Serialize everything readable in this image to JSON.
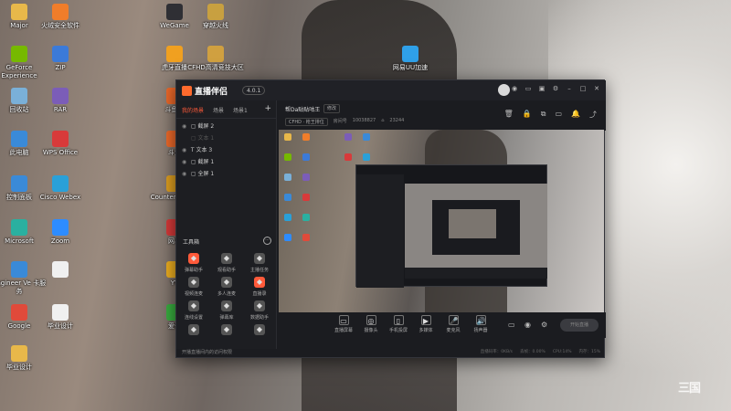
{
  "desktop": {
    "icons": [
      {
        "label": "Major",
        "icon": "folder-icon",
        "color": "#e8b84a"
      },
      {
        "label": "火绒安全软件",
        "icon": "shield-icon",
        "color": "#f07d2a"
      },
      {
        "label": "WeGame",
        "icon": "wegame-icon",
        "color": "#2f2f34"
      },
      {
        "label": "穿越火线",
        "icon": "game-icon",
        "color": "#c8a040"
      },
      {
        "label": "GeForce Experience",
        "icon": "geforce-icon",
        "color": "#76b900"
      },
      {
        "label": "ZIP",
        "icon": "zip-icon",
        "color": "#3b7ad8"
      },
      {
        "label": "虎牙直播",
        "icon": "huya-icon",
        "color": "#f0a020"
      },
      {
        "label": "CFHD高清竞技大区",
        "icon": "game-icon",
        "color": "#d0a040"
      },
      {
        "label": "网易UU加速",
        "icon": "uu-icon",
        "color": "#2fa0e8"
      },
      {
        "label": "回收站",
        "icon": "recycle-bin-icon",
        "color": "#7ab0d8"
      },
      {
        "label": "RAR",
        "icon": "rar-icon",
        "color": "#7b5db8"
      },
      {
        "label": "斗鱼直",
        "icon": "douyu-icon",
        "color": "#f06a2a"
      },
      {
        "label": "此电脑",
        "icon": "computer-icon",
        "color": "#3a8ad8"
      },
      {
        "label": "WPS Office",
        "icon": "wps-icon",
        "color": "#d83a3a"
      },
      {
        "label": "斗鱼",
        "icon": "douyu-icon",
        "color": "#f06a2a"
      },
      {
        "label": "控制面板",
        "icon": "control-panel-icon",
        "color": "#3a8ad8"
      },
      {
        "label": "Cisco Webex",
        "icon": "webex-icon",
        "color": "#2aa0d8"
      },
      {
        "label": "Counter Global",
        "icon": "cs-icon",
        "color": "#e0a020"
      },
      {
        "label": "Microsoft",
        "icon": "edge-icon",
        "color": "#2ab0a0"
      },
      {
        "label": "Zoom",
        "icon": "zoom-icon",
        "color": "#2d8cff"
      },
      {
        "label": "网易",
        "icon": "netease-icon",
        "color": "#d83a3a"
      },
      {
        "label": "Engineer Ve 卡服务",
        "icon": "tool-icon",
        "color": "#3a8ad8"
      },
      {
        "label": "",
        "icon": "file-icon",
        "color": "#f0f0f0"
      },
      {
        "label": "YY",
        "icon": "yy-icon",
        "color": "#f0b020"
      },
      {
        "label": "Google",
        "icon": "chrome-icon",
        "color": "#e04a3a"
      },
      {
        "label": "毕业设计",
        "icon": "file-icon",
        "color": "#f0f0f0"
      },
      {
        "label": "爱奇",
        "icon": "iqiyi-icon",
        "color": "#3ab040"
      },
      {
        "label": "毕业设计",
        "icon": "folder-icon",
        "color": "#e8b84a"
      }
    ]
  },
  "app": {
    "title": "直播伴侣",
    "version": "4.0.1",
    "window_controls": [
      "skin-icon",
      "message-icon",
      "gift-icon",
      "settings-icon",
      "minimize-icon",
      "maximize-icon",
      "close-icon"
    ],
    "tabs": [
      "我的场景",
      "场景",
      "场景1"
    ],
    "tab_add": "+",
    "scenes": [
      {
        "label": "截屏 2",
        "dim": false
      },
      {
        "label": "文本 1",
        "dim": true
      },
      {
        "label": "文本 3",
        "dim": false
      },
      {
        "label": "截屏 1",
        "dim": false
      },
      {
        "label": "全屏 1",
        "dim": false
      }
    ],
    "toolbox_title": "工具箱",
    "toolbox_more": "···",
    "tools": [
      {
        "label": "弹幕助手",
        "icon": "danmaku-icon",
        "color": "#ff5a3a"
      },
      {
        "label": "观看助手",
        "icon": "viewer-icon",
        "color": "#555"
      },
      {
        "label": "主播任务",
        "icon": "task-icon",
        "color": "#555"
      },
      {
        "label": "视频连麦",
        "icon": "video-link-icon",
        "color": "#555"
      },
      {
        "label": "多人连麦",
        "icon": "multi-link-icon",
        "color": "#555"
      },
      {
        "label": "直播录",
        "icon": "record-icon",
        "color": "#ff5a3a"
      },
      {
        "label": "连线设置",
        "icon": "connect-icon",
        "color": "#555"
      },
      {
        "label": "弹幕库",
        "icon": "library-icon",
        "color": "#555"
      },
      {
        "label": "数据助手",
        "icon": "data-icon",
        "color": "#555"
      },
      {
        "label": "",
        "icon": "game-pad-icon",
        "color": "#555"
      },
      {
        "label": "",
        "icon": "download-icon",
        "color": "#555"
      },
      {
        "label": "",
        "icon": "more-tool-icon",
        "color": "#555"
      }
    ],
    "notice": "开播直播间内的访问权限",
    "room": {
      "name": "帮Da贴贴咕王",
      "edit": "修改",
      "category": "CFHD · 枪王排位",
      "room_label": "房间号",
      "room_id": "10038827",
      "fans_icon": "home-icon",
      "fans": "23244",
      "tools": [
        "trash-icon",
        "lock-icon",
        "copy-icon",
        "screen-icon",
        "bell-icon",
        "share-icon"
      ]
    },
    "bottom": [
      {
        "label": "直播屏幕",
        "icon": "screen-cast-icon"
      },
      {
        "label": "摄像头",
        "icon": "camera-icon"
      },
      {
        "label": "手机投屏",
        "icon": "phone-cast-icon"
      },
      {
        "label": "多媒体",
        "icon": "media-icon"
      },
      {
        "label": "麦克风",
        "icon": "mic-icon"
      },
      {
        "label": "扬声器",
        "icon": "speaker-icon"
      }
    ],
    "bottom_small": [
      "record-icon",
      "eye-icon",
      "gear-icon"
    ],
    "go_live": "开始直播",
    "status": [
      "直播码率：0KB/s",
      "丢帧：0.00%",
      "CPU:14%",
      "内存：15%"
    ]
  },
  "watermark": "三国"
}
